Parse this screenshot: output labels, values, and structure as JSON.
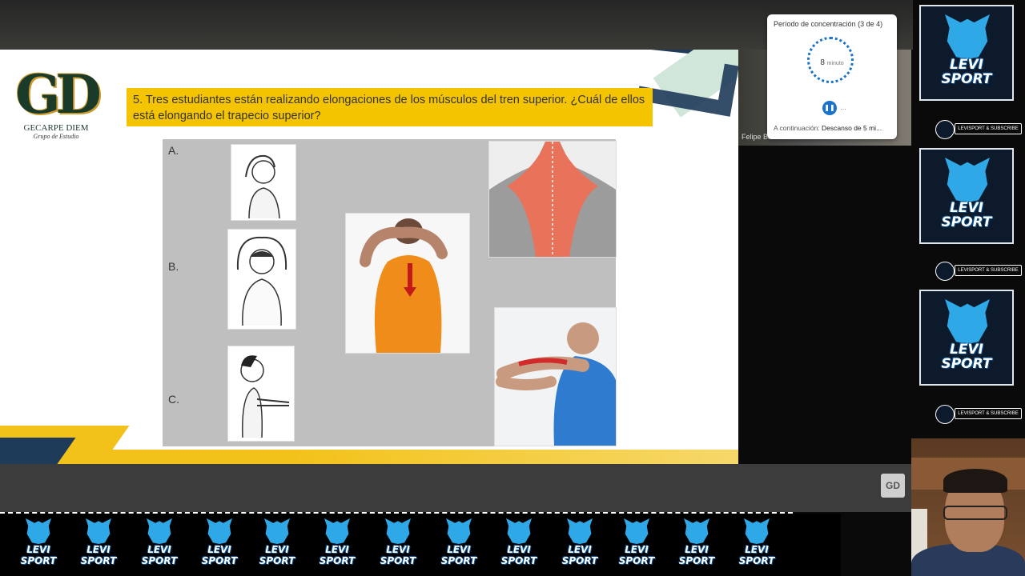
{
  "slide": {
    "logo": {
      "initials": "GD",
      "name": "GECARPE DIEM",
      "tagline": "Grupo de Estudio"
    },
    "question": "5. Tres estudiantes están realizando elongaciones de los músculos del tren superior. ¿Cuál de ellos está elongando el trapecio superior?",
    "options": [
      {
        "label": "A."
      },
      {
        "label": "B."
      },
      {
        "label": "C."
      }
    ]
  },
  "participant": {
    "name": "Felipe Baca Educación"
  },
  "focus_timer": {
    "title": "Período de concentración (3 de 4)",
    "minutes": "8",
    "unit": "minuto",
    "next_prefix": "A continuación:",
    "next_value": "Descanso de 5 mi...",
    "more": "..."
  },
  "brand": {
    "line1": "LEVI",
    "line2": "SPORT",
    "banner": "LEVISPORT & SUBSCRIBE"
  },
  "footer": {
    "gd_icon": "GD"
  },
  "colors": {
    "accent": "#f5c400",
    "navy": "#1f3b5a",
    "timer_blue": "#1a73c9"
  }
}
